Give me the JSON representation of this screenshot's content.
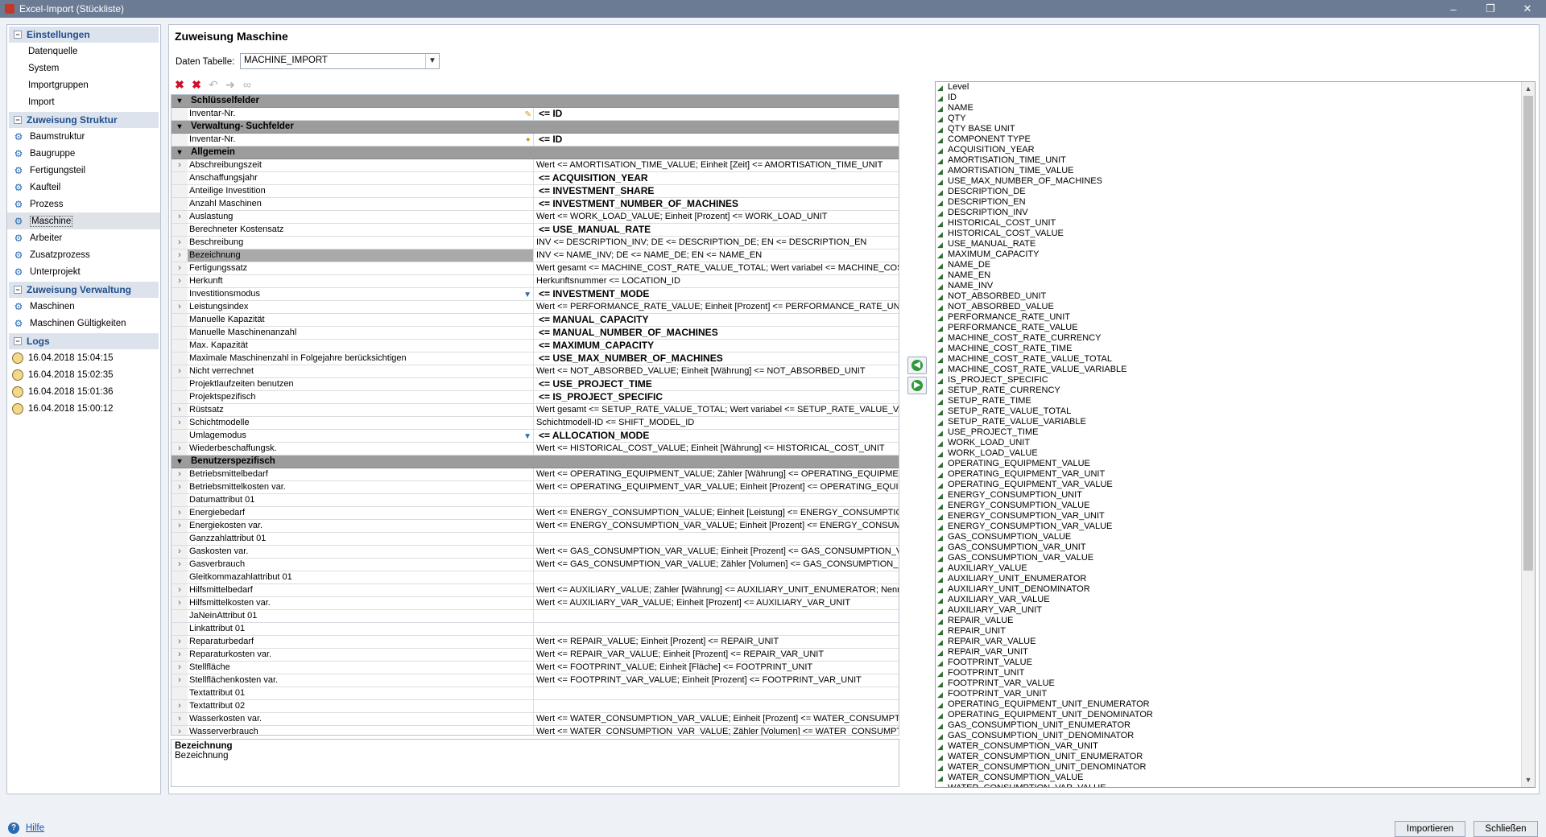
{
  "window": {
    "title": "Excel-Import (Stückliste)",
    "controls": [
      "–",
      "❐",
      "✕"
    ]
  },
  "sidebar": {
    "groups": [
      {
        "title": "Einstellungen",
        "items": [
          {
            "label": "Datenquelle"
          },
          {
            "label": "System"
          },
          {
            "label": "Importgruppen"
          },
          {
            "label": "Import"
          }
        ]
      },
      {
        "title": "Zuweisung Struktur",
        "items": [
          {
            "label": "Baumstruktur"
          },
          {
            "label": "Baugruppe"
          },
          {
            "label": "Fertigungsteil"
          },
          {
            "label": "Kaufteil"
          },
          {
            "label": "Prozess"
          },
          {
            "label": "Maschine",
            "selected": true
          },
          {
            "label": "Arbeiter"
          },
          {
            "label": "Zusatzprozess"
          },
          {
            "label": "Unterprojekt"
          }
        ]
      },
      {
        "title": "Zuweisung Verwaltung",
        "items": [
          {
            "label": "Maschinen"
          },
          {
            "label": "Maschinen Gültigkeiten"
          }
        ]
      },
      {
        "title": "Logs",
        "items": [
          {
            "label": "16.04.2018 15:04:15"
          },
          {
            "label": "16.04.2018 15:02:35"
          },
          {
            "label": "16.04.2018 15:01:36"
          },
          {
            "label": "16.04.2018 15:00:12"
          }
        ]
      }
    ]
  },
  "main": {
    "title": "Zuweisung Maschine",
    "daten_tabelle_label": "Daten Tabelle:",
    "daten_tabelle_value": "MACHINE_IMPORT",
    "grid": [
      {
        "type": "group",
        "name": "Schlüsselfelder"
      },
      {
        "type": "row",
        "name": "Inventar-Nr.",
        "value": "<= ID",
        "bold": true,
        "flag": "edit",
        "exp": ""
      },
      {
        "type": "group",
        "name": "Verwaltung- Suchfelder"
      },
      {
        "type": "row",
        "name": "Inventar-Nr.",
        "value": "<= ID",
        "bold": true,
        "flag": "key",
        "exp": ""
      },
      {
        "type": "group",
        "name": "Allgemein"
      },
      {
        "type": "row",
        "name": "Abschreibungszeit",
        "value": "Wert <= AMORTISATION_TIME_VALUE; Einheit  [Zeit] <= AMORTISATION_TIME_UNIT",
        "exp": ">"
      },
      {
        "type": "row",
        "name": "Anschaffungsjahr",
        "value": "<= ACQUISITION_YEAR",
        "bold": true,
        "exp": ""
      },
      {
        "type": "row",
        "name": "Anteilige Investition",
        "value": "<= INVESTMENT_SHARE",
        "bold": true,
        "exp": ""
      },
      {
        "type": "row",
        "name": "Anzahl Maschinen",
        "value": "<= INVESTMENT_NUMBER_OF_MACHINES",
        "bold": true,
        "exp": ""
      },
      {
        "type": "row",
        "name": "Auslastung",
        "value": "Wert <= WORK_LOAD_VALUE; Einheit  [Prozent] <= WORK_LOAD_UNIT",
        "exp": ">"
      },
      {
        "type": "row",
        "name": "Berechneter Kostensatz",
        "value": "<= USE_MANUAL_RATE",
        "bold": true,
        "exp": ""
      },
      {
        "type": "row",
        "name": "Beschreibung",
        "value": "INV <= DESCRIPTION_INV; DE <= DESCRIPTION_DE; EN <= DESCRIPTION_EN",
        "exp": ">"
      },
      {
        "type": "row",
        "name": "Bezeichnung",
        "value": "INV <= NAME_INV; DE <= NAME_DE; EN <= NAME_EN",
        "exp": ">",
        "highlight": true
      },
      {
        "type": "row",
        "name": "Fertigungssatz",
        "value": "Wert gesamt <= MACHINE_COST_RATE_VALUE_TOTAL; Wert variabel <= MACHINE_COST_",
        "exp": ">"
      },
      {
        "type": "row",
        "name": "Herkunft",
        "value": "Herkunftsnummer <= LOCATION_ID",
        "exp": ">"
      },
      {
        "type": "row",
        "name": "Investitionsmodus",
        "value": "<= INVESTMENT_MODE",
        "bold": true,
        "flag": "filter",
        "exp": ""
      },
      {
        "type": "row",
        "name": "Leistungsindex",
        "value": "Wert <= PERFORMANCE_RATE_VALUE; Einheit  [Prozent] <= PERFORMANCE_RATE_UNIT",
        "exp": ">"
      },
      {
        "type": "row",
        "name": "Manuelle Kapazität",
        "value": "<= MANUAL_CAPACITY",
        "bold": true,
        "exp": ""
      },
      {
        "type": "row",
        "name": "Manuelle Maschinenanzahl",
        "value": "<= MANUAL_NUMBER_OF_MACHINES",
        "bold": true,
        "exp": ""
      },
      {
        "type": "row",
        "name": "Max. Kapazität",
        "value": "<= MAXIMUM_CAPACITY",
        "bold": true,
        "exp": ""
      },
      {
        "type": "row",
        "name": "Maximale Maschinenzahl in Folgejahre berücksichtigen",
        "value": "<= USE_MAX_NUMBER_OF_MACHINES",
        "bold": true,
        "exp": ""
      },
      {
        "type": "row",
        "name": "Nicht verrechnet",
        "value": "Wert <= NOT_ABSORBED_VALUE; Einheit  [Währung] <= NOT_ABSORBED_UNIT",
        "exp": ">"
      },
      {
        "type": "row",
        "name": "Projektlaufzeiten benutzen",
        "value": "<= USE_PROJECT_TIME",
        "bold": true,
        "exp": ""
      },
      {
        "type": "row",
        "name": "Projektspezifisch",
        "value": "<= IS_PROJECT_SPECIFIC",
        "bold": true,
        "exp": ""
      },
      {
        "type": "row",
        "name": "Rüstsatz",
        "value": "Wert gesamt <= SETUP_RATE_VALUE_TOTAL; Wert variabel <= SETUP_RATE_VALUE_VAR",
        "exp": ">"
      },
      {
        "type": "row",
        "name": "Schichtmodelle",
        "value": "Schichtmodell-ID <= SHIFT_MODEL_ID",
        "exp": ">"
      },
      {
        "type": "row",
        "name": "Umlagemodus",
        "value": "<= ALLOCATION_MODE",
        "bold": true,
        "flag": "filter",
        "exp": ""
      },
      {
        "type": "row",
        "name": "Wiederbeschaffungsk.",
        "value": "Wert <= HISTORICAL_COST_VALUE; Einheit  [Währung] <= HISTORICAL_COST_UNIT",
        "exp": ">"
      },
      {
        "type": "group",
        "name": "Benutzerspezifisch"
      },
      {
        "type": "row",
        "name": "Betriebsmittelbedarf",
        "value": "Wert <= OPERATING_EQUIPMENT_VALUE; Zähler  [Währung] <= OPERATING_EQUIPMENT",
        "exp": ">"
      },
      {
        "type": "row",
        "name": "Betriebsmittelkosten var.",
        "value": "Wert <= OPERATING_EQUIPMENT_VAR_VALUE; Einheit  [Prozent] <= OPERATING_EQUIPM",
        "exp": ">"
      },
      {
        "type": "row",
        "name": "Datumattribut 01",
        "value": "",
        "exp": ""
      },
      {
        "type": "row",
        "name": "Energiebedarf",
        "value": "Wert <= ENERGY_CONSUMPTION_VALUE; Einheit  [Leistung] <= ENERGY_CONSUMPTION_",
        "exp": ">"
      },
      {
        "type": "row",
        "name": "Energiekosten var.",
        "value": "Wert <= ENERGY_CONSUMPTION_VAR_VALUE; Einheit  [Prozent] <= ENERGY_CONSUMPT",
        "exp": ">"
      },
      {
        "type": "row",
        "name": "Ganzzahlattribut 01",
        "value": "",
        "exp": ""
      },
      {
        "type": "row",
        "name": "Gaskosten var.",
        "value": "Wert <= GAS_CONSUMPTION_VAR_VALUE; Einheit  [Prozent] <= GAS_CONSUMPTION_VAR",
        "exp": ">"
      },
      {
        "type": "row",
        "name": "Gasverbrauch",
        "value": "Wert <= GAS_CONSUMPTION_VAR_VALUE; Zähler  [Volumen] <= GAS_CONSUMPTION_UNIT_EN",
        "exp": ">"
      },
      {
        "type": "row",
        "name": "Gleitkommazahlattribut 01",
        "value": "",
        "exp": ""
      },
      {
        "type": "row",
        "name": "Hilfsmittelbedarf",
        "value": "Wert <= AUXILIARY_VALUE; Zähler  [Währung] <= AUXILIARY_UNIT_ENUMERATOR; Nenne",
        "exp": ">"
      },
      {
        "type": "row",
        "name": "Hilfsmittelkosten var.",
        "value": "Wert <= AUXILIARY_VAR_VALUE; Einheit  [Prozent] <= AUXILIARY_VAR_UNIT",
        "exp": ">"
      },
      {
        "type": "row",
        "name": "JaNeinAttribut 01",
        "value": "",
        "exp": ""
      },
      {
        "type": "row",
        "name": "Linkattribut 01",
        "value": "",
        "exp": ""
      },
      {
        "type": "row",
        "name": "Reparaturbedarf",
        "value": "Wert <= REPAIR_VALUE; Einheit  [Prozent] <= REPAIR_UNIT",
        "exp": ">"
      },
      {
        "type": "row",
        "name": "Reparaturkosten var.",
        "value": "Wert <= REPAIR_VAR_VALUE; Einheit  [Prozent] <= REPAIR_VAR_UNIT",
        "exp": ">"
      },
      {
        "type": "row",
        "name": "Stellfläche",
        "value": "Wert <= FOOTPRINT_VALUE; Einheit  [Fläche] <= FOOTPRINT_UNIT",
        "exp": ">"
      },
      {
        "type": "row",
        "name": "Stellflächenkosten var.",
        "value": "Wert <= FOOTPRINT_VAR_VALUE; Einheit  [Prozent] <= FOOTPRINT_VAR_UNIT",
        "exp": ">"
      },
      {
        "type": "row",
        "name": "Textattribut 01",
        "value": "",
        "exp": ""
      },
      {
        "type": "row",
        "name": "Textattribut 02",
        "value": "",
        "exp": ">"
      },
      {
        "type": "row",
        "name": "Wasserkosten var.",
        "value": "Wert <= WATER_CONSUMPTION_VAR_VALUE; Einheit  [Prozent] <= WATER_CONSUMPTIO",
        "exp": ">"
      },
      {
        "type": "row",
        "name": "Wasserverbrauch",
        "value": "Wert <= WATER_CONSUMPTION_VAR_VALUE; Zähler  [Volumen] <= WATER_CONSUMPTION_U",
        "exp": ">"
      }
    ],
    "description": {
      "title": "Bezeichnung",
      "text": "Bezeichnung"
    }
  },
  "fields": [
    "Level",
    "ID",
    "NAME",
    "QTY",
    "QTY BASE UNIT",
    "COMPONENT TYPE",
    "ACQUISITION_YEAR",
    "AMORTISATION_TIME_UNIT",
    "AMORTISATION_TIME_VALUE",
    "USE_MAX_NUMBER_OF_MACHINES",
    "DESCRIPTION_DE",
    "DESCRIPTION_EN",
    "DESCRIPTION_INV",
    "HISTORICAL_COST_UNIT",
    "HISTORICAL_COST_VALUE",
    "USE_MANUAL_RATE",
    "MAXIMUM_CAPACITY",
    "NAME_DE",
    "NAME_EN",
    "NAME_INV",
    "NOT_ABSORBED_UNIT",
    "NOT_ABSORBED_VALUE",
    "PERFORMANCE_RATE_UNIT",
    "PERFORMANCE_RATE_VALUE",
    "MACHINE_COST_RATE_CURRENCY",
    "MACHINE_COST_RATE_TIME",
    "MACHINE_COST_RATE_VALUE_TOTAL",
    "MACHINE_COST_RATE_VALUE_VARIABLE",
    "IS_PROJECT_SPECIFIC",
    "SETUP_RATE_CURRENCY",
    "SETUP_RATE_TIME",
    "SETUP_RATE_VALUE_TOTAL",
    "SETUP_RATE_VALUE_VARIABLE",
    "USE_PROJECT_TIME",
    "WORK_LOAD_UNIT",
    "WORK_LOAD_VALUE",
    "OPERATING_EQUIPMENT_VALUE",
    "OPERATING_EQUIPMENT_VAR_UNIT",
    "OPERATING_EQUIPMENT_VAR_VALUE",
    "ENERGY_CONSUMPTION_UNIT",
    "ENERGY_CONSUMPTION_VALUE",
    "ENERGY_CONSUMPTION_VAR_UNIT",
    "ENERGY_CONSUMPTION_VAR_VALUE",
    "GAS_CONSUMPTION_VALUE",
    "GAS_CONSUMPTION_VAR_UNIT",
    "GAS_CONSUMPTION_VAR_VALUE",
    "AUXILIARY_VALUE",
    "AUXILIARY_UNIT_ENUMERATOR",
    "AUXILIARY_UNIT_DENOMINATOR",
    "AUXILIARY_VAR_VALUE",
    "AUXILIARY_VAR_UNIT",
    "REPAIR_VALUE",
    "REPAIR_UNIT",
    "REPAIR_VAR_VALUE",
    "REPAIR_VAR_UNIT",
    "FOOTPRINT_VALUE",
    "FOOTPRINT_UNIT",
    "FOOTPRINT_VAR_VALUE",
    "FOOTPRINT_VAR_UNIT",
    "OPERATING_EQUIPMENT_UNIT_ENUMERATOR",
    "OPERATING_EQUIPMENT_UNIT_DENOMINATOR",
    "GAS_CONSUMPTION_UNIT_ENUMERATOR",
    "GAS_CONSUMPTION_UNIT_DENOMINATOR",
    "WATER_CONSUMPTION_VAR_UNIT",
    "WATER_CONSUMPTION_UNIT_ENUMERATOR",
    "WATER_CONSUMPTION_UNIT_DENOMINATOR",
    "WATER_CONSUMPTION_VALUE",
    "WATER_CONSUMPTION_VAR_VALUE"
  ],
  "footer": {
    "help_label": "Hilfe",
    "import_label": "Importieren",
    "close_label": "Schließen"
  },
  "colors": {
    "titlebar": "#6b7b93",
    "group_header": "#9c9c9c",
    "nav_header_text": "#1f4e8c"
  }
}
